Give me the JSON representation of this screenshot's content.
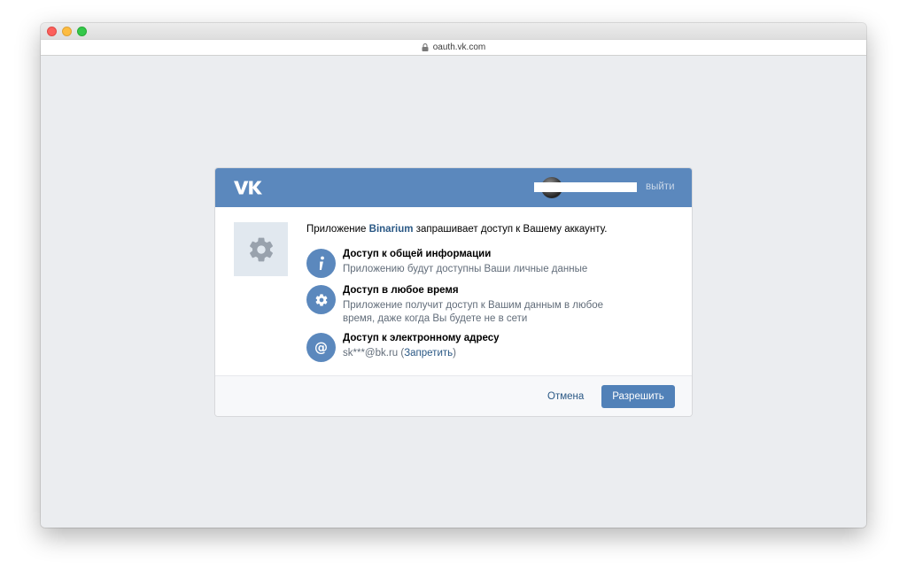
{
  "browser": {
    "url": "oauth.vk.com"
  },
  "header": {
    "logo": "VK",
    "logout_label": "выйти"
  },
  "app": {
    "icon": "gear-icon"
  },
  "request": {
    "prefix": "Приложение ",
    "app_name": "Binarium",
    "suffix": " запрашивает доступ к Вашему аккаунту."
  },
  "permissions": [
    {
      "icon": "info-icon",
      "title": "Доступ к общей информации",
      "desc_lines": [
        "Приложению будут доступны Ваши личные данные"
      ]
    },
    {
      "icon": "gear-icon",
      "title": "Доступ в любое время",
      "desc_lines": [
        "Приложение получит доступ к Вашим данным в любое",
        "время, даже когда Вы будете не в сети"
      ]
    },
    {
      "icon": "at-icon",
      "title": "Доступ к электронному адресу",
      "email": "sk***@bk.ru",
      "deny_open": " (",
      "deny_label": "Запретить",
      "deny_close": ")"
    }
  ],
  "footer": {
    "cancel_label": "Отмена",
    "allow_label": "Разрешить"
  },
  "colors": {
    "header_bg": "#5b88bd",
    "accent": "#5181b8",
    "link": "#2a5885"
  }
}
